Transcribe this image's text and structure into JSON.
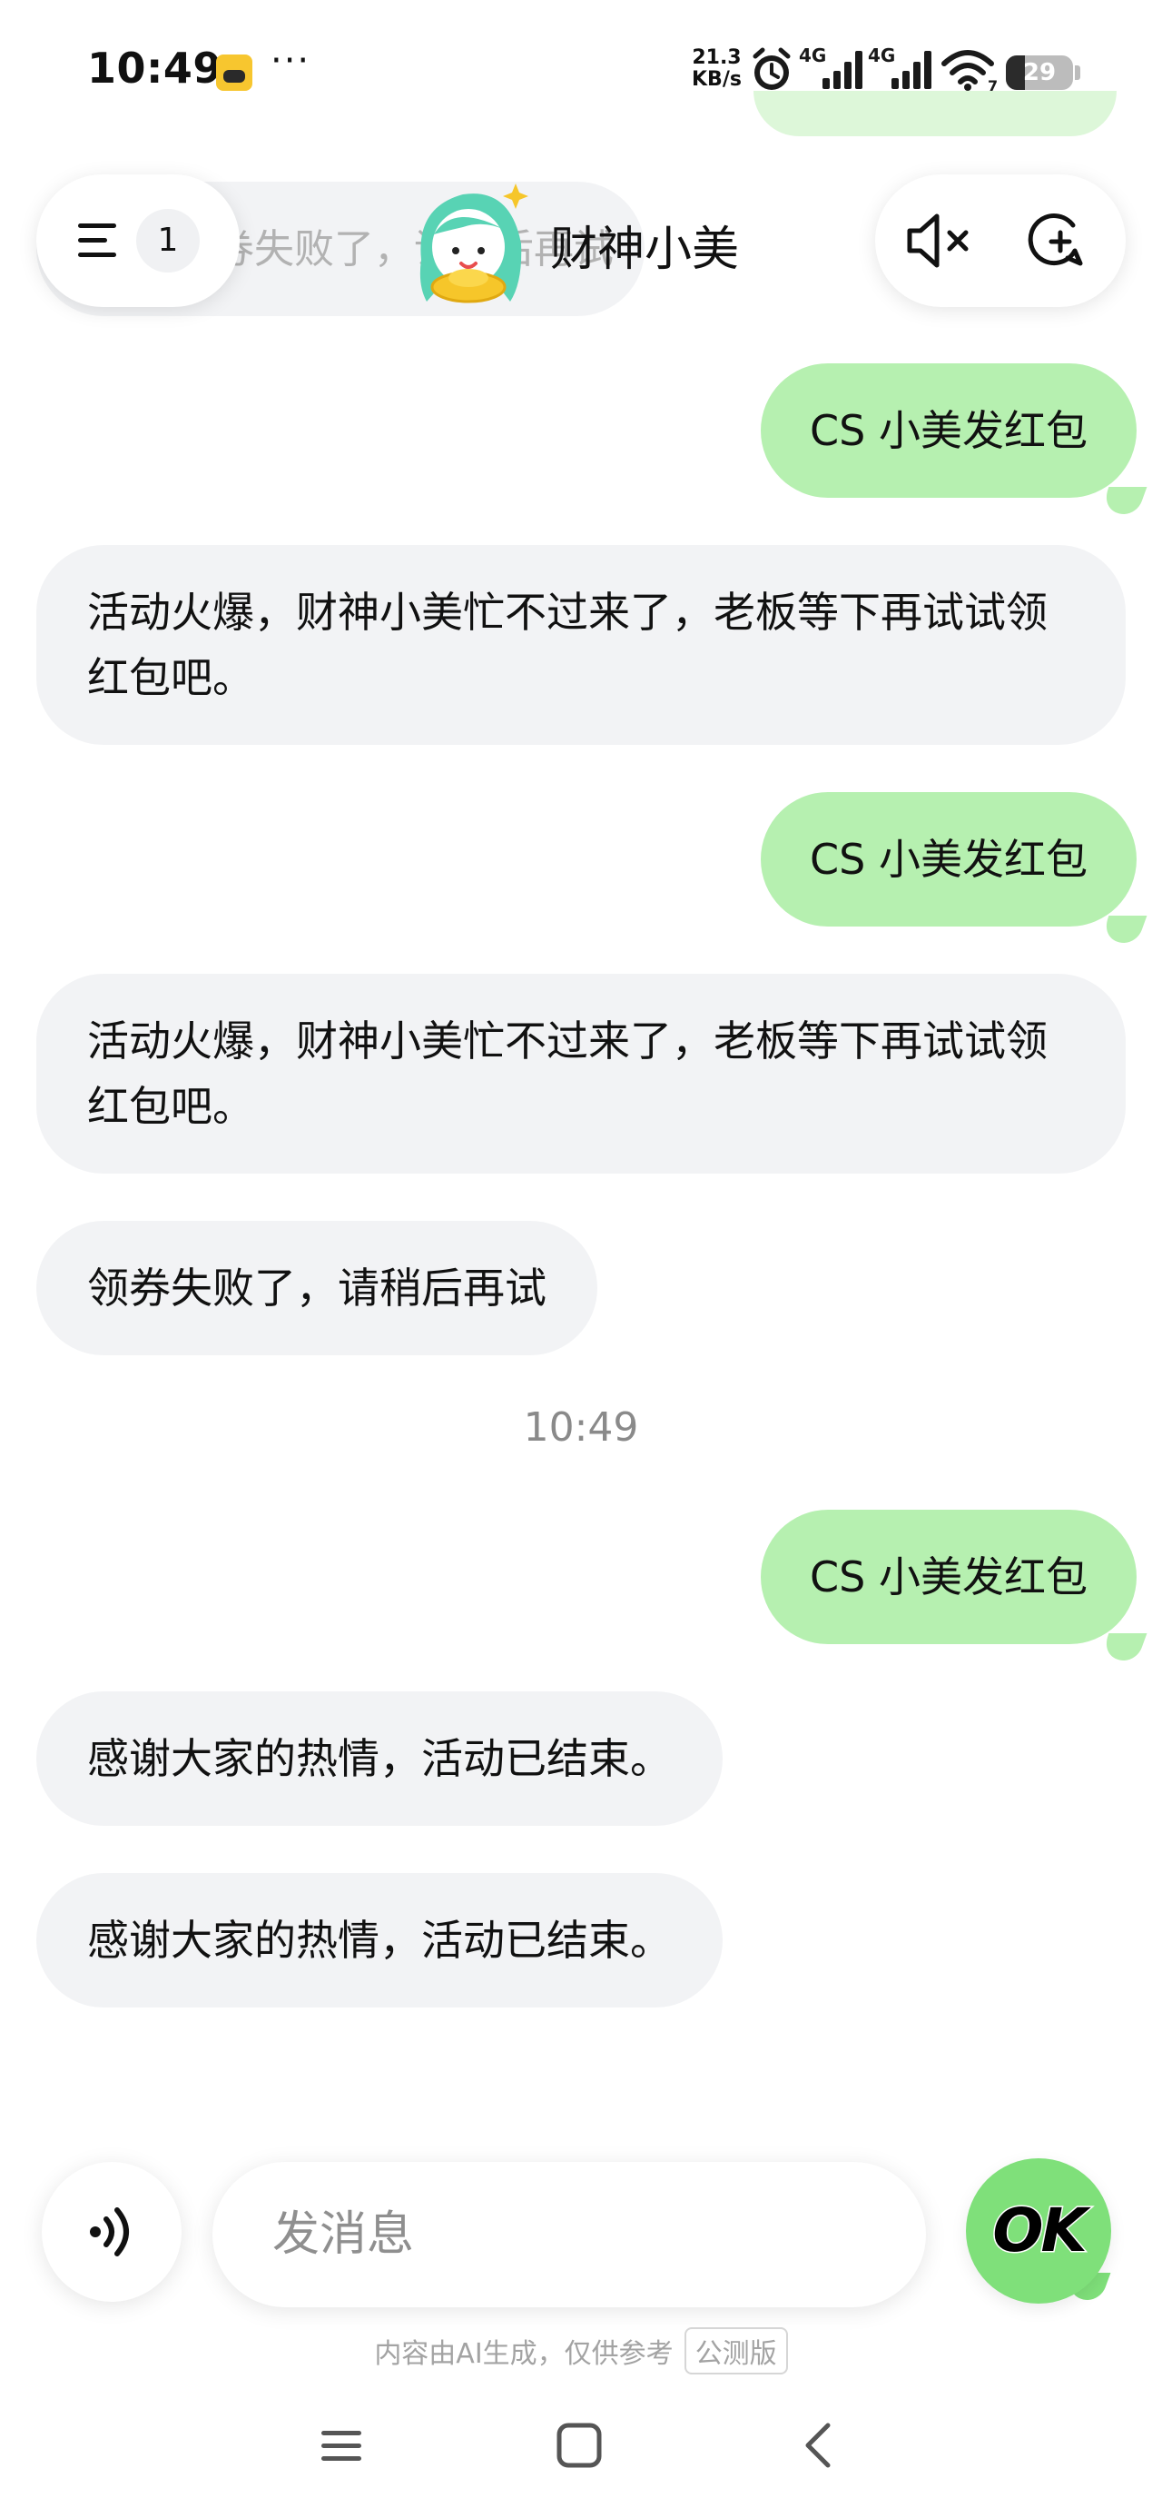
{
  "status_bar": {
    "time": "10:49",
    "more_dots": "···",
    "net_speed_value": "21.3",
    "net_speed_unit": "KB/s",
    "signal_1_label": "4G",
    "signal_2_label": "4G",
    "wifi_label": "7",
    "battery_level": "29",
    "battery_fraction": 0.29
  },
  "header": {
    "bot_name": "财神小美",
    "unread_count": "1",
    "scrolled_message_text": "领券失败了，请稍后再试"
  },
  "messages": [
    {
      "role": "user",
      "text": "CS 小美发红包"
    },
    {
      "role": "bot",
      "text": "活动火爆，财神小美忙不过来了，老板等下再试试领红包吧。"
    },
    {
      "role": "user",
      "text": "CS 小美发红包"
    },
    {
      "role": "bot",
      "text": "活动火爆，财神小美忙不过来了，老板等下再试试领红包吧。"
    },
    {
      "role": "bot",
      "text": "领券失败了，请稍后再试"
    },
    {
      "role": "time",
      "text": "10:49"
    },
    {
      "role": "user",
      "text": "CS 小美发红包"
    },
    {
      "role": "bot",
      "text": "感谢大家的热情，活动已结束。"
    },
    {
      "role": "bot",
      "text": "感谢大家的热情，活动已结束。"
    }
  ],
  "composer": {
    "placeholder": "发消息",
    "ok_label": "OK"
  },
  "disclaimer": {
    "text": "内容由AI生成，仅供参考",
    "beta_tag": "公测版"
  },
  "colors": {
    "user_bubble": "#b6f0b0",
    "bot_bubble": "#f2f3f5",
    "accent_green": "#7fe07a"
  },
  "icons": {
    "menu": "menu-icon",
    "mute": "mute-icon",
    "new_chat": "new-chat-icon",
    "voice": "voice-icon",
    "nav_menu": "nav-menu-icon",
    "nav_home": "nav-home-icon",
    "nav_back": "nav-back-icon"
  }
}
